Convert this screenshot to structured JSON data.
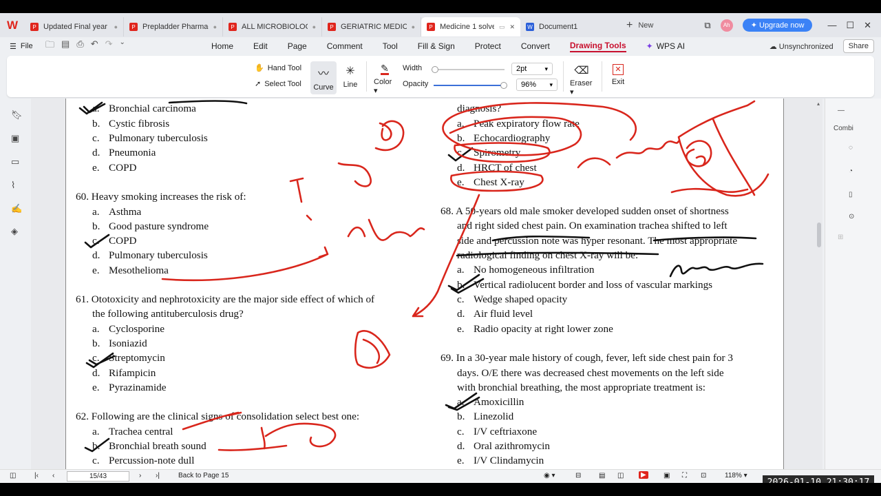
{
  "tabs": [
    {
      "title": "Updated Final year M",
      "icon": "pdf"
    },
    {
      "title": "Prepladder Pharmaco",
      "icon": "pdf"
    },
    {
      "title": "ALL MICROBIOLOGY :",
      "icon": "pdf"
    },
    {
      "title": "GERIATRIC MEDICINE W",
      "icon": "pdf"
    },
    {
      "title": "Medicine 1 solve",
      "icon": "pdf",
      "active": true
    },
    {
      "title": "Document1",
      "icon": "word"
    }
  ],
  "new_tab_label": "New",
  "avatar_initials": "Ah",
  "upgrade_label": "Upgrade now",
  "file_label": "File",
  "menus": [
    "Home",
    "Edit",
    "Page",
    "Comment",
    "Tool",
    "Fill & Sign",
    "Protect",
    "Convert",
    "Drawing Tools",
    "WPS AI"
  ],
  "active_menu": "Drawing Tools",
  "sync_status": "Unsynchronized",
  "share_label": "Share",
  "ribbon": {
    "hand_tool": "Hand Tool",
    "select_tool": "Select Tool",
    "curve": "Curve",
    "line": "Line",
    "color": "Color",
    "width_label": "Width",
    "width_value": "2pt",
    "opacity_label": "Opacity",
    "opacity_value": "96%",
    "opacity_fraction": 0.96,
    "eraser": "Eraser",
    "exit": "Exit",
    "pen_color": "#d9261c"
  },
  "document": {
    "left_column": [
      {
        "letter": "a.",
        "text": "Bronchial carcinoma"
      },
      {
        "letter": "b.",
        "text": "Cystic fibrosis"
      },
      {
        "letter": "c.",
        "text": "Pulmonary tuberculosis"
      },
      {
        "letter": "d.",
        "text": "Pneumonia"
      },
      {
        "letter": "e.",
        "text": "COPD"
      }
    ],
    "q60": {
      "stem": "60. Heavy smoking increases the risk of:",
      "options": [
        {
          "letter": "a.",
          "text": "Asthma"
        },
        {
          "letter": "b.",
          "text": "Good pasture syndrome"
        },
        {
          "letter": "c.",
          "text": "COPD"
        },
        {
          "letter": "d.",
          "text": "Pulmonary tuberculosis"
        },
        {
          "letter": "e.",
          "text": "Mesothelioma"
        }
      ]
    },
    "q61": {
      "stem1": "61. Ototoxicity and nephrotoxicity are the major side effect of which of",
      "stem2": "the following antituberculosis drug?",
      "options": [
        {
          "letter": "a.",
          "text": "Cyclosporine"
        },
        {
          "letter": "b.",
          "text": "Isoniazid"
        },
        {
          "letter": "c.",
          "text": "Streptomycin"
        },
        {
          "letter": "d.",
          "text": "Rifampicin"
        },
        {
          "letter": "e.",
          "text": "Pyrazinamide"
        }
      ]
    },
    "q62": {
      "stem": "62. Following are the clinical signs of consolidation select best one:",
      "options": [
        {
          "letter": "a.",
          "text": "Trachea central"
        },
        {
          "letter": "b.",
          "text": "Bronchial breath sound"
        },
        {
          "letter": "c.",
          "text": "Percussion-note dull"
        }
      ]
    },
    "q67": {
      "stem_tail": "diagnosis?",
      "options": [
        {
          "letter": "a.",
          "text": "Peak expiratory flow rate"
        },
        {
          "letter": "b.",
          "text": "Echocardiography"
        },
        {
          "letter": "c.",
          "text": "Spirometry"
        },
        {
          "letter": "d.",
          "text": "HRCT of chest"
        },
        {
          "letter": "e.",
          "text": "Chest X-ray"
        }
      ]
    },
    "q68": {
      "stem1": "68. A 50-years old male smoker developed sudden onset of shortness",
      "stem2": "and right sided chest pain. On examination trachea shifted to left",
      "stem3": "side and percussion note was hyper resonant. The most appropriate",
      "stem4": "radiological finding on chest X-ray will be:",
      "options": [
        {
          "letter": "a.",
          "text": "No homogeneous infiltration"
        },
        {
          "letter": "b.",
          "text": "Vertical radiolucent border and loss of vascular markings"
        },
        {
          "letter": "c.",
          "text": "Wedge shaped opacity"
        },
        {
          "letter": "d.",
          "text": "Air fluid level"
        },
        {
          "letter": "e.",
          "text": "Radio opacity at right lower zone"
        }
      ]
    },
    "q69": {
      "stem1": "69. In a 30-year male history of cough, fever, left side chest pain for 3",
      "stem2": "days. O/E there was decreased chest movements on the left side",
      "stem3": "with bronchial breathing, the most appropriate treatment is:",
      "options": [
        {
          "letter": "a.",
          "text": "Amoxicillin"
        },
        {
          "letter": "b.",
          "text": "Linezolid"
        },
        {
          "letter": "c.",
          "text": "I/V ceftriaxone"
        },
        {
          "letter": "d.",
          "text": "Oral azithromycin"
        },
        {
          "letter": "e.",
          "text": "I/V Clindamycin"
        }
      ]
    }
  },
  "right_panel": {
    "combi": "Combi"
  },
  "status": {
    "page_indicator": "15/43",
    "back_label": "Back to Page 15",
    "zoom": "118%"
  },
  "timestamp": "2026-01-10  21:30:17"
}
